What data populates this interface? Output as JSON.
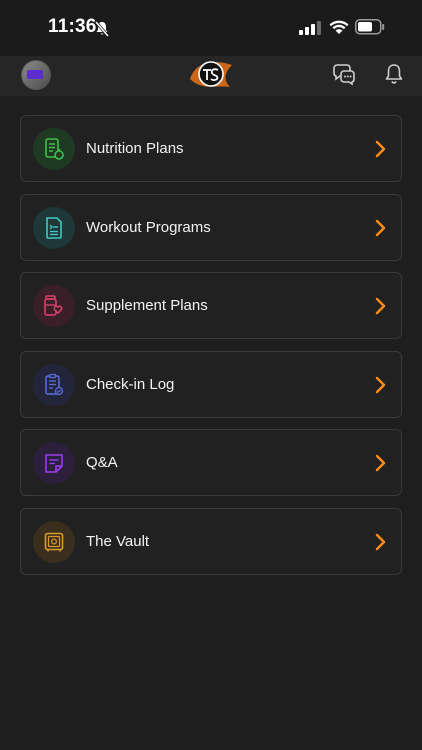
{
  "status_bar": {
    "time": "11:36"
  },
  "header": {
    "avatar": "avatar",
    "logo": "app-logo",
    "chat_icon": "chat-bubbles-icon",
    "bell_icon": "bell-icon"
  },
  "accent_color": "#ff8c1a",
  "menu": {
    "items": [
      {
        "label": "Nutrition Plans",
        "icon": "nutrition-icon",
        "color": "#3fbf4a",
        "bg": "#1f3a22"
      },
      {
        "label": "Workout Programs",
        "icon": "workout-program-icon",
        "color": "#3ec9c4",
        "bg": "#1d3837"
      },
      {
        "label": "Supplement Plans",
        "icon": "supplement-icon",
        "color": "#e0406e",
        "bg": "#3a1f28"
      },
      {
        "label": "Check-in Log",
        "icon": "checklist-icon",
        "color": "#5a6de0",
        "bg": "#23263a"
      },
      {
        "label": "Q&A",
        "icon": "note-icon",
        "color": "#9b3df0",
        "bg": "#2c1f3c"
      },
      {
        "label": "The Vault",
        "icon": "vault-icon",
        "color": "#d99a2b",
        "bg": "#3a2f1d"
      }
    ]
  }
}
